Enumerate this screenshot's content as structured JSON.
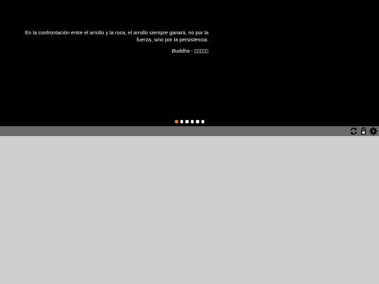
{
  "hero": {
    "quote": "En la confrontación entre el arrollo y la roca, el arrollo siempre ganará, no por la fuerza, sino por la persistencia.",
    "author": "Buddha",
    "author_separator": " - ",
    "author_source": "▯▯▯▯▯"
  },
  "carousel": {
    "slide_count": 6,
    "active_index": 0,
    "colors": {
      "active": "#e87b2c",
      "inactive": "#ffffff"
    }
  },
  "toolbar": {
    "icons": [
      "refresh-icon",
      "lock-icon",
      "gear-icon"
    ]
  },
  "colors": {
    "hero_bg": "#000000",
    "toolbar_bg": "#6a6a6a",
    "content_bg": "#cfcfcf"
  }
}
